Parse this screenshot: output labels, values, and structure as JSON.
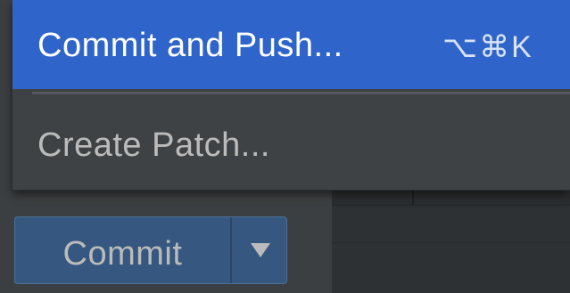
{
  "menu": {
    "items": [
      {
        "label": "Commit and Push...",
        "shortcut": "⌥⌘K",
        "selected": true
      },
      {
        "label": "Create Patch...",
        "selected": false
      }
    ]
  },
  "commit_button": {
    "label": "Commit",
    "dropdown_icon": "triangle-down-icon"
  },
  "colors": {
    "selection": "#2f65ca",
    "popup_bg": "#3e4244",
    "button_bg": "#365880",
    "window_bg": "#3c3f41"
  }
}
